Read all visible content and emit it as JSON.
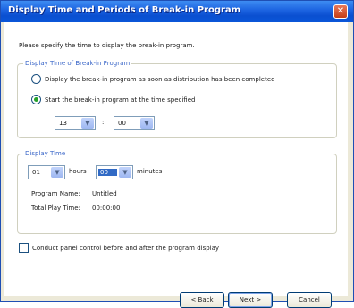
{
  "window": {
    "title": "Display Time and Periods of Break-in Program",
    "close_glyph": "✕"
  },
  "intro": "Please specify the time to display the break-in program.",
  "group1": {
    "legend": "Display Time of Break-in Program",
    "option1": "Display the break-in program as soon as distribution has been completed",
    "option2": "Start the break-in program at the time specified",
    "selected_option": 2,
    "hour": "13",
    "separator": ":",
    "minute": "00"
  },
  "group2": {
    "legend": "Display Time",
    "hours_value": "01",
    "hours_label": "hours",
    "minutes_value": "00",
    "minutes_label": "minutes",
    "program_name_label": "Program Name:",
    "program_name_value": "Untitled",
    "total_play_label": "Total Play Time:",
    "total_play_value": "00:00:00"
  },
  "panel_control_label": "Conduct panel control before and after the program display",
  "panel_control_checked": false,
  "buttons": {
    "back": "< Back",
    "next": "Next >",
    "cancel": "Cancel"
  },
  "colors": {
    "title_bar": "#1b62e0",
    "legend": "#3a66c8",
    "radio_dot": "#25a12a"
  },
  "icons": {
    "dropdown": "▼"
  }
}
